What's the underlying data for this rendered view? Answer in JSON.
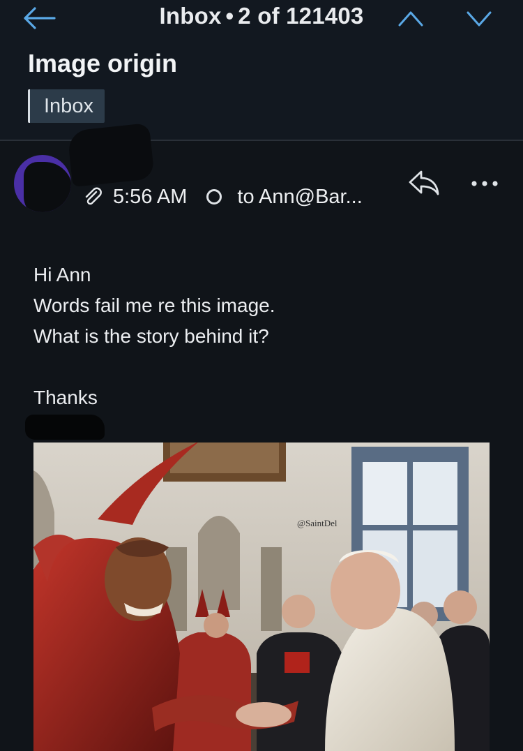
{
  "header": {
    "folder_name": "Inbox",
    "separator": "•",
    "position": "2 of 121403",
    "back_icon": "arrow-left-icon",
    "prev_icon": "chevron-up-icon",
    "next_icon": "chevron-down-icon"
  },
  "message": {
    "subject": "Image origin",
    "folder_chip": "Inbox",
    "time": "5:56 AM",
    "recipient": "to Ann@Bar...",
    "attachment_icon": "paperclip-icon",
    "reply_icon": "reply-icon",
    "more_icon": "more-horizontal-icon",
    "body": {
      "greeting": "Hi Ann",
      "line1": "Words fail me re this image.",
      "line2": "What is the story behind it?",
      "closing": "Thanks"
    },
    "image": {
      "watermark": "@SaintDel"
    }
  },
  "colors": {
    "background": "#101419",
    "chip": "#2c3b49",
    "accent": "#5aa8e6",
    "avatar": "#4a2fa6"
  }
}
